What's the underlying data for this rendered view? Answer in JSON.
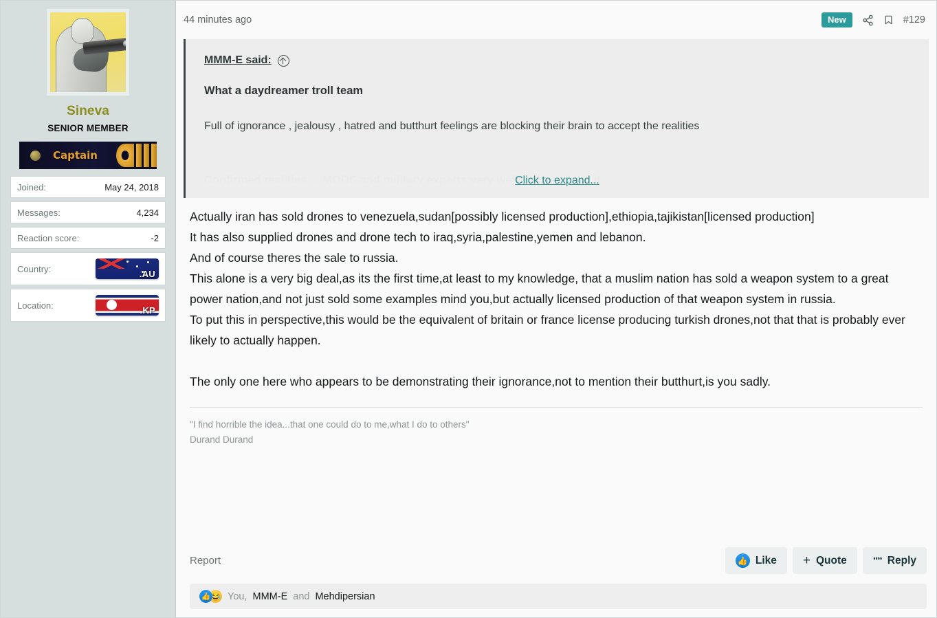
{
  "theme": {
    "accent": "#2b9b9b",
    "sidebar_bg": "#d6dfde",
    "content_bg": "#fafafa",
    "quote_bg": "#ededed",
    "username_color": "#8b8b1e",
    "like_blue": "#0b7ad6"
  },
  "sidebar": {
    "avatar_alt": "user-avatar",
    "username": "Sineva",
    "user_title": "SENIOR MEMBER",
    "rank_banner": {
      "label": "Captain",
      "icon": "rank-insignia"
    },
    "info_rows": [
      {
        "label": "Joined:",
        "value": "May 24, 2018",
        "type": "text"
      },
      {
        "label": "Messages:",
        "value": "4,234",
        "type": "text"
      },
      {
        "label": "Reaction score:",
        "value": "-2",
        "type": "text"
      },
      {
        "label": "Country:",
        "value": ".AU",
        "type": "flag",
        "flag": "australia-flag"
      },
      {
        "label": "Location:",
        "value": ".KP",
        "type": "flag",
        "flag": "north-korea-flag"
      }
    ]
  },
  "post": {
    "date": "44 minutes ago",
    "new_badge": "New",
    "share_icon": "share-icon",
    "bookmark_icon": "bookmark-icon",
    "post_number": "#129",
    "quote": {
      "author": "MMM-E",
      "said_suffix": " said:",
      "author_full": "MMM-E said:",
      "jump_icon": "jump-to-post-icon",
      "heading": "What a daydreamer troll team",
      "line": "Full of ignorance , jealousy , hatred and butthurt feelings are blocking their brain to accept the realities",
      "faded_line": "Confirmed realities ... MODS and military experts very well knows about it",
      "expand_label": "Click to expand..."
    },
    "body": [
      "Actually iran has sold drones to venezuela,sudan[possibly licensed production],ethiopia,tajikistan[licensed production]",
      "It has also supplied drones and drone tech to iraq,syria,palestine,yemen and lebanon.",
      "And of course theres the sale to russia.",
      "This alone is a very big deal,as its the first time,at least to my knowledge, that a muslim nation has sold a weapon system to a great power nation,and not just sold some examples mind you,but actually licensed production of that weapon system in russia.",
      "To put this in perspective,this would be the equivalent of britain or france license producing turkish drones,not that that is probably ever likely to actually happen."
    ],
    "body_final": "The only one here who appears to be demonstrating their ignorance,not to mention their butthurt,is you sadly.",
    "signature": {
      "quote": "\"I find horrible the idea...that one could do to me,what I do to others\"",
      "attribution": "Durand Durand"
    },
    "footer": {
      "report_label": "Report",
      "like_label": "Like",
      "like_icon": "thumbs-up-icon",
      "quote_label": "Quote",
      "quote_icon": "plus-icon",
      "reply_label": "Reply",
      "reply_icon": "quote-marks-icon"
    },
    "reactions": {
      "emoji_like": "thumbs-up-reaction",
      "emoji_haha": "laughing-reaction",
      "you": "You,",
      "first_user": "MMM-E",
      "conjunction": "and",
      "second_user": "Mehdipersian"
    }
  }
}
